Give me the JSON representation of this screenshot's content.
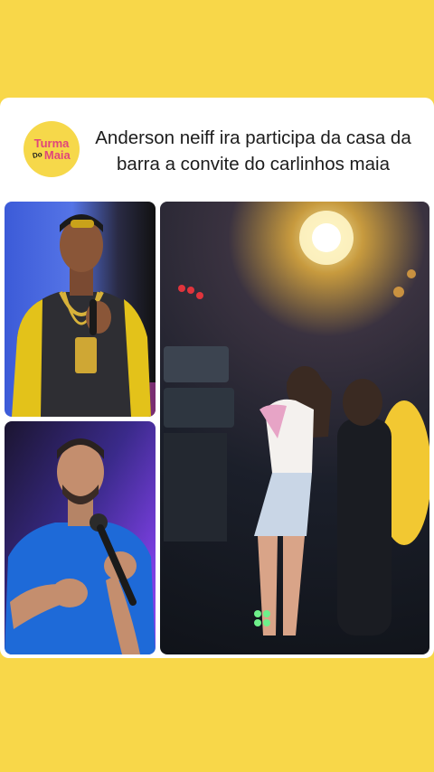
{
  "post": {
    "logo": {
      "line1": "Turma",
      "line2": "Do",
      "line3": "Maia"
    },
    "headline": "Anderson neiff ira participa da casa da barra a convite do carlinhos maia"
  },
  "photos": [
    {
      "name": "singer-photo"
    },
    {
      "name": "comedian-photo"
    },
    {
      "name": "party-photo"
    }
  ],
  "colors": {
    "background": "#F8D749",
    "card": "#FFFFFF",
    "logo_bg": "#F6D84A",
    "logo_pink": "#E0457B",
    "text": "#1C1C1C"
  }
}
